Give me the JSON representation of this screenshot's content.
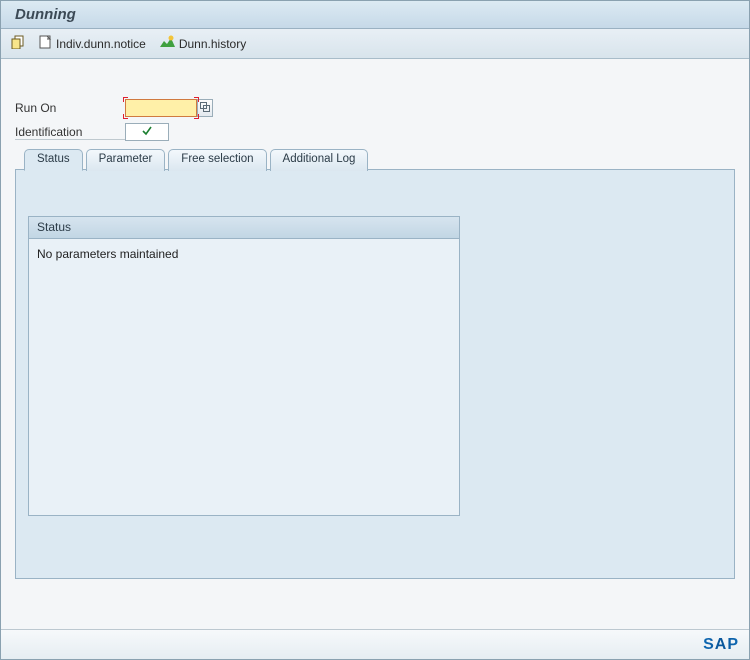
{
  "title": "Dunning",
  "toolbar": {
    "indiv_label": "Indiv.dunn.notice",
    "history_label": "Dunn.history"
  },
  "form": {
    "run_on_label": "Run On",
    "run_on_value": "",
    "identification_label": "Identification",
    "identification_value": ""
  },
  "tabs": [
    {
      "label": "Status",
      "active": true
    },
    {
      "label": "Parameter",
      "active": false
    },
    {
      "label": "Free selection",
      "active": false
    },
    {
      "label": "Additional Log",
      "active": false
    }
  ],
  "status_group": {
    "header": "Status",
    "message": "No parameters maintained"
  },
  "footer": {
    "logo": "SAP"
  }
}
